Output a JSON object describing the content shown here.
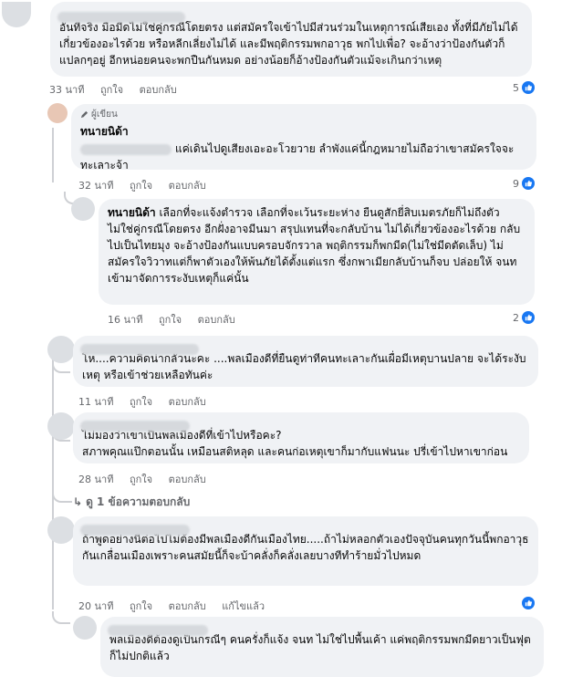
{
  "comments": [
    {
      "text": "อันที่จริง มือมีดไม่ใช่คู่กรณีโดยตรง แต่สมัครใจเข้าไปมีส่วนร่วมในเหตุการณ์เสียเอง ทั้งที่มีภัยไม่ได้เกี่ยวข้องอะไรด้วย หรือหลีกเลี่ยงไม่ได้ และมีพฤติกรรมพกอาวุธ พกไปเพื่อ? จะอ้างว่าป้องกันตัวก็แปลกๆอยู่ อีกหน่อยคนจะพกปืนกันหมด อย่างน้อยก็อ้างป้องกันตัวแม้จะเกินกว่าเหตุ",
      "time": "33 นาที",
      "like": "ถูกใจ",
      "reply": "ตอบกลับ",
      "reactions": "5"
    },
    {
      "badge": "ผู้เขียน",
      "name": "ทนายนิด้า",
      "text": "แค่เดินไปดูเสียงเอะอะโวยวาย ลำพังแค่นี้กฎหมายไม่ถือว่าเขาสมัครใจจะทะเลาะจ้า",
      "time": "32 นาที",
      "like": "ถูกใจ",
      "reply": "ตอบกลับ",
      "reactions": "9"
    },
    {
      "name": "ทนายนิด้า",
      "text": "เลือกที่จะแจ้งตำรวจ เลือกที่จะเว้นระยะห่าง ยืนดูสักยี่สิบเมตรภัยก็ไม่ถึงตัว ไม่ใช่คู่กรณีโดยตรง อีกฝั่งอาจมีนมา สรุปแทนที่จะกลับบ้าน ไม่ได้เกี่ยวข้องอะไรด้วย กลับไปเป็นไทยมุง จะอ้างป้องกันแบบครอบจักรวาล พฤติกรรมก็พกมีด(ไม่ใช่มีดตัดเล็บ) ไม่สมัครใจวิวาทแต่ก็พาตัวเองให้พ้นภัยได้ตั้งแต่แรก ซึ่งกพาเมียกลับบ้านก็จบ ปล่อยให้ จนท เข้ามาจัดการระงับเหตุก็แค่นั้น",
      "time": "16 นาที",
      "like": "ถูกใจ",
      "reply": "ตอบกลับ",
      "reactions": "2"
    },
    {
      "text": "โห....ความคิดน่ากลัวนะคะ ....พลเมืองดีที่ยืนดูท่าทีคนทะเลาะกันเผื่อมีเหตุบานปลาย จะได้ระงับเหตุ หรือเข้าช่วยเหลือทันค่ะ",
      "time": "11 นาที",
      "like": "ถูกใจ",
      "reply": "ตอบกลับ"
    },
    {
      "text": "ไม่มองว่าเขาเป็นพลเมืองดีที่เข้าไปหรือคะ?\nสภาพคุณแป๊กตอนนั้น เหมือนสติหลุด และคนก่อเหตุเขาก็มากับแฟนนะ ปรี่เข้าไปหาเขาก่อน",
      "time": "28 นาที",
      "like": "ถูกใจ",
      "reply": "ตอบกลับ"
    },
    {
      "text": "ถ้าพูดอย่างนี้ต่อไปไม่ต้องมีพลเมืองดีกันเมืองไทย.....ถ้าไม่หลอกตัวเองปัจจุบันคนทุกวันนี้พกอาวุธกันเกลื่อนเมืองเพราะคนสมัยนี้ก็จะบ้าคลั่งก็คลั่งเลยบางทีทำร้ายมั่วไปหมด",
      "time": "20 นาที",
      "like": "ถูกใจ",
      "reply": "ตอบกลับ",
      "edited": "แก้ไขแล้ว"
    },
    {
      "text": "พลเมืองดีต้องดูเป็นกรณีๆ คนครั่งก็แจ้ง จนท ไม่ใช่ไปพื้นเค้า แค่พฤติกรรมพกมีดยาวเป็นฟุต ก็ไม่ปกติแล้ว"
    }
  ],
  "more_replies": "ดู 1 ข้อความตอบกลับ",
  "colors": {
    "bubble": "#f0f2f5",
    "meta": "#65676b",
    "like": "#1877f2"
  }
}
